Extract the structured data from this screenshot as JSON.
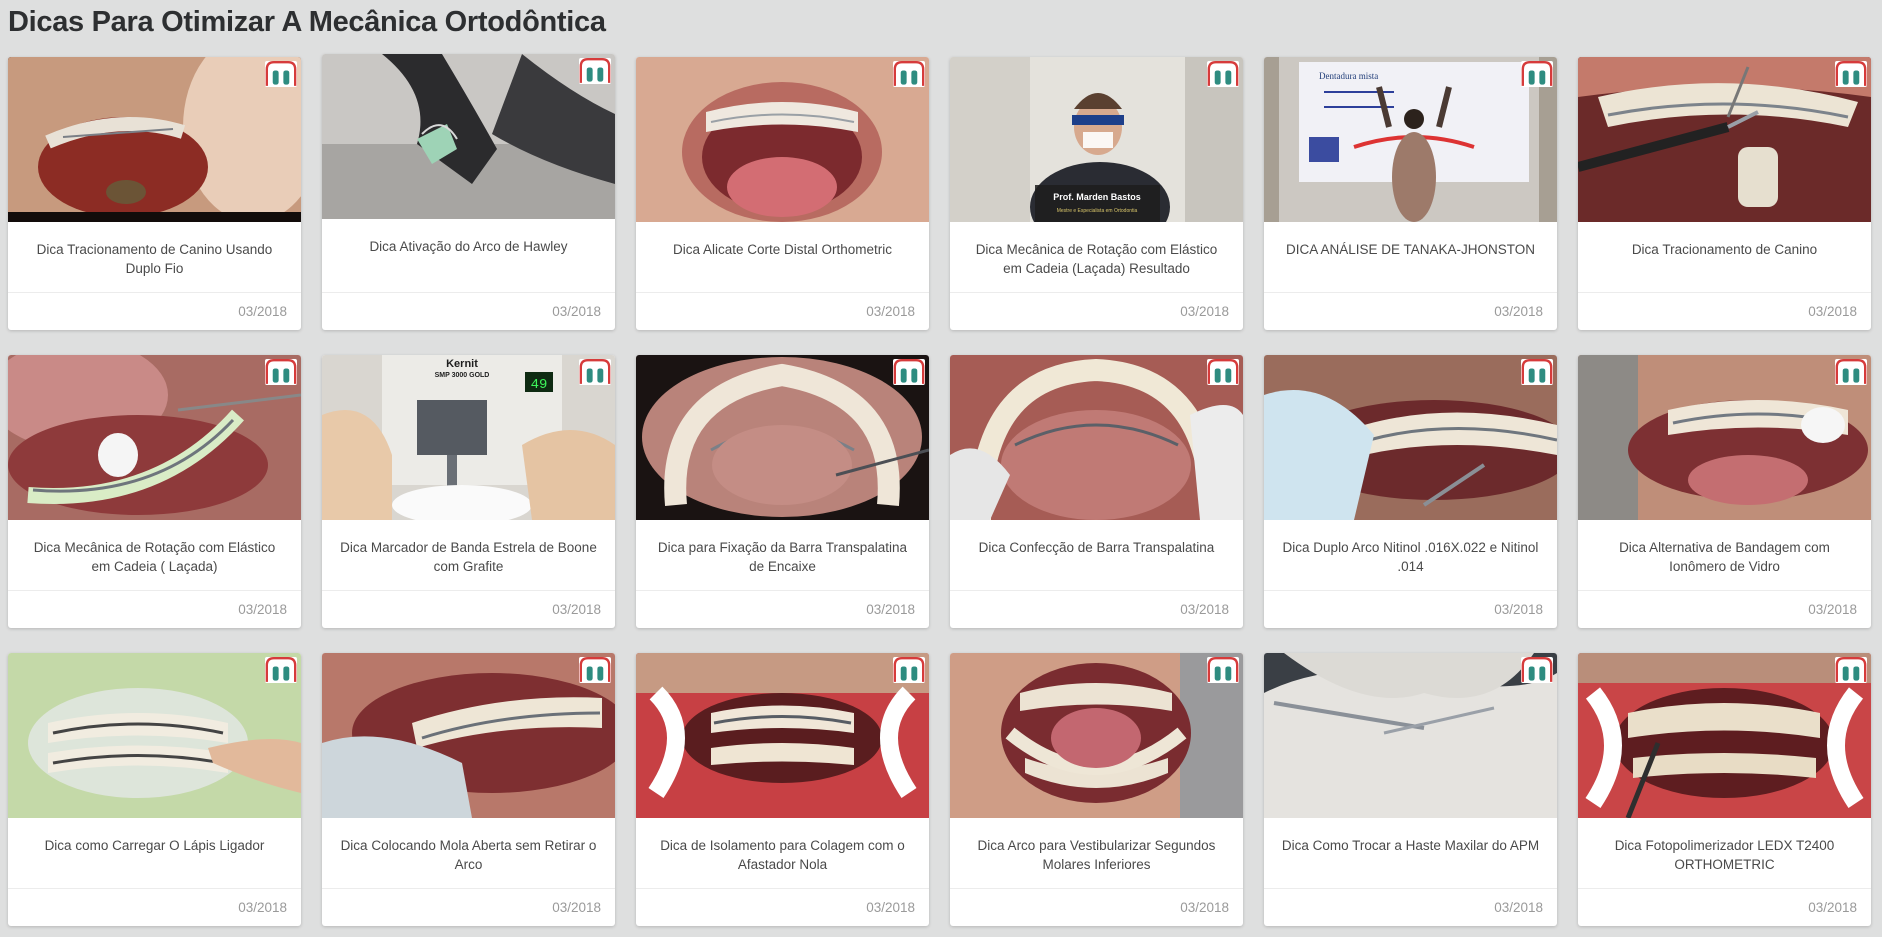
{
  "page": {
    "title": "Dicas Para Otimizar A Mecânica Ortodôntica"
  },
  "cards": [
    {
      "title": "Dica Tracionamento de Canino Usando Duplo Fio",
      "date": "03/2018"
    },
    {
      "title": "Dica Ativação do Arco de Hawley",
      "date": "03/2018"
    },
    {
      "title": "Dica Alicate Corte Distal Orthometric",
      "date": "03/2018"
    },
    {
      "title": "Dica Mecânica de Rotação com Elástico em Cadeia (Laçada) Resultado",
      "date": "03/2018",
      "overlay_name": "Prof. Marden Bastos",
      "overlay_sub": "Mestre e Especialista em Ortodontia"
    },
    {
      "title": "DICA ANÁLISE DE TANAKA-JHONSTON",
      "date": "03/2018",
      "slide_text": "Dentadura mista"
    },
    {
      "title": "Dica Tracionamento de Canino",
      "date": "03/2018"
    },
    {
      "title": "Dica Mecânica de Rotação com Elástico em Cadeia ( Laçada)",
      "date": "03/2018"
    },
    {
      "title": "Dica Marcador de Banda Estrela de Boone com Grafite",
      "date": "03/2018",
      "device_brand": "Kernit",
      "device_model": "SMP 3000 GOLD",
      "device_display": "49"
    },
    {
      "title": "Dica para Fixação da Barra Transpalatina de Encaixe",
      "date": "03/2018"
    },
    {
      "title": "Dica Confecção de Barra Transpalatina",
      "date": "03/2018"
    },
    {
      "title": "Dica Duplo Arco Nitinol .016X.022 e Nitinol .014",
      "date": "03/2018"
    },
    {
      "title": "Dica Alternativa de Bandagem com Ionômero de Vidro",
      "date": "03/2018"
    },
    {
      "title": "Dica como Carregar O Lápis Ligador",
      "date": "03/2018"
    },
    {
      "title": "Dica Colocando Mola Aberta sem Retirar o Arco",
      "date": "03/2018"
    },
    {
      "title": "Dica de Isolamento para Colagem com o Afastador Nola",
      "date": "03/2018"
    },
    {
      "title": "Dica Arco para Vestibularizar Segundos Molares Inferiores",
      "date": "03/2018"
    },
    {
      "title": "Dica Como Trocar a Haste Maxilar do APM",
      "date": "03/2018"
    },
    {
      "title": "Dica Fotopolimerizador LEDX T2400 ORTHOMETRIC",
      "date": "03/2018"
    }
  ],
  "colors": {
    "logo_red": "#d63b3b",
    "logo_teal": "#2e8c80"
  }
}
